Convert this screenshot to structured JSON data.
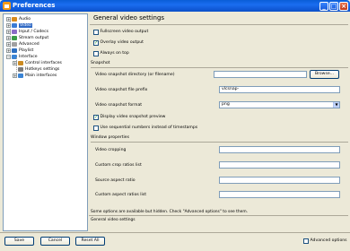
{
  "window": {
    "title": "Preferences"
  },
  "tree": {
    "items": [
      {
        "label": "Audio",
        "expander": "+",
        "icon_color": "#d98b1c"
      },
      {
        "label": "Video",
        "expander": "+",
        "icon_color": "#3a7bd5"
      },
      {
        "label": "Input / Codecs",
        "expander": "+",
        "icon_color": "#8a6cc7"
      },
      {
        "label": "Stream output",
        "expander": "+",
        "icon_color": "#3b9c49"
      },
      {
        "label": "Advanced",
        "expander": "+",
        "icon_color": "#a0a0a0"
      },
      {
        "label": "Playlist",
        "expander": "+",
        "icon_color": "#2d6fc0"
      },
      {
        "label": "Interface",
        "expander": "−",
        "icon_color": "#3a84d5"
      },
      {
        "label": "Control interfaces",
        "expander": "+",
        "icon_color": "#cc8b22"
      },
      {
        "label": "Hotkeys settings",
        "expander": "",
        "icon_color": "#7a7a7a"
      },
      {
        "label": "Main interfaces",
        "expander": "+",
        "icon_color": "#3a84d5"
      }
    ],
    "selected_index": 1
  },
  "panel": {
    "title": "General video settings",
    "checkboxes": [
      {
        "label": "Fullscreen video output",
        "checked": false
      },
      {
        "label": "Overlay video output",
        "checked": true
      },
      {
        "label": "Always on top",
        "checked": false
      }
    ],
    "snapshot": {
      "heading": "Snapshot",
      "directory_label": "Video snapshot directory (or filename)",
      "directory_value": "",
      "browse_label": "Browse...",
      "prefix_label": "Video snapshot file prefix",
      "prefix_value": "vlcsnap-",
      "format_label": "Video snapshot format",
      "format_value": "png",
      "preview_label": "Display video snapshot preview",
      "preview_checked": true,
      "sequential_label": "Use sequential numbers instead of timestamps",
      "sequential_checked": false
    },
    "window_props": {
      "heading": "Window properties",
      "fields": [
        {
          "label": "Video cropping",
          "value": ""
        },
        {
          "label": "Custom crop ratios list",
          "value": ""
        },
        {
          "label": "Source aspect ratio",
          "value": ""
        },
        {
          "label": "Custom aspect ratios list",
          "value": ""
        }
      ]
    },
    "hidden_note": "Some options are available but hidden. Check \"Advanced options\" to see them.",
    "status": "General video settings"
  },
  "footer": {
    "save_label": "Save",
    "cancel_label": "Cancel",
    "reset_label": "Reset All",
    "advanced_label": "Advanced options",
    "advanced_checked": false
  }
}
